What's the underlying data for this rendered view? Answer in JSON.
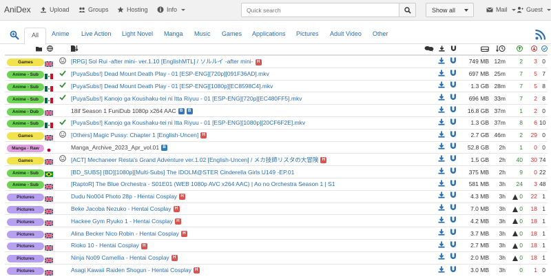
{
  "nav": {
    "brand": "AniDex",
    "upload": "Upload",
    "groups": "Groups",
    "hosting": "Hosting",
    "info": "Info",
    "search_placeholder": "Quick search",
    "show_all": "Show all",
    "mail": "Mail",
    "guest": "Guest"
  },
  "tabs": [
    "All",
    "Anime",
    "Live Action",
    "Light Novel",
    "Manga",
    "Music",
    "Games",
    "Applications",
    "Pictures",
    "Adult Video",
    "Other"
  ],
  "colors": {
    "Games": "#f2e24d",
    "Anime - Sub": "#6fd455",
    "Anime - Dub": "#6fd455",
    "Manga - Raw": "#e0a0e0",
    "Pictures": "#b8a0f0",
    "badge_h": "#d9534f",
    "badge_b": "#337ab7",
    "link": "#2a6fb0"
  },
  "rows": [
    {
      "cat": "Games",
      "flag": "uk",
      "status": "smile",
      "name": "[RPG] Sol Rui -after mini- ver.1.10 [EnglishMTL] / ソルルイ -after mini-",
      "badges": [
        "H"
      ],
      "size": "749 MB",
      "age": "12m",
      "seed": "2",
      "leech": "3",
      "comp": "0",
      "mono": false,
      "warn": false
    },
    {
      "cat": "Anime - Sub",
      "flag": "mx",
      "status": "check",
      "name": "[PuyaSubs!] Dead Mount Death Play - 01 [ESP-ENG][720p][091F36AD].mkv",
      "badges": [],
      "size": "697 MB",
      "age": "25m",
      "seed": "7",
      "leech": "5",
      "comp": "7",
      "mono": false,
      "warn": false
    },
    {
      "cat": "Anime - Sub",
      "flag": "mx",
      "status": "check",
      "name": "[PuyaSubs!] Dead Mount Death Play - 01 [ESP-ENG][1080p][EC8598C4].mkv",
      "badges": [],
      "size": "1.3 GB",
      "age": "28m",
      "seed": "7",
      "leech": "5",
      "comp": "8",
      "mono": false,
      "warn": false
    },
    {
      "cat": "Anime - Sub",
      "flag": "mx",
      "status": "check",
      "name": "[PuyaSubs!] Kanojo ga Koushaku-tei ni Itta Riyuu - 01 [ESP-ENG][720p][EC480FF5].mkv",
      "badges": [],
      "size": "696 MB",
      "age": "33m",
      "seed": "7",
      "leech": "2",
      "comp": "8",
      "mono": false,
      "warn": false
    },
    {
      "cat": "Anime - Dub",
      "flag": "uk",
      "status": "",
      "name": "18if Season 1 FuniDub 1080p x264 AAC",
      "badges": [
        "B",
        "B"
      ],
      "size": "16.8 GB",
      "age": "37m",
      "seed": "1",
      "leech": "2",
      "comp": "0",
      "mono": true,
      "warn": false
    },
    {
      "cat": "Anime - Sub",
      "flag": "mx",
      "status": "check",
      "name": "[PuyaSubs!] Kanojo ga Koushaku-tei ni Itta Riyuu - 01 [ESP-ENG][1080p][20CF6F2E].mkv",
      "badges": [],
      "size": "1.3 GB",
      "age": "37m",
      "seed": "8",
      "leech": "6",
      "comp": "10",
      "mono": false,
      "warn": false
    },
    {
      "cat": "Games",
      "flag": "uk",
      "status": "smile",
      "name": "[Others] Magic Pussy: Chapter 1 [English-Uncen]",
      "badges": [
        "H"
      ],
      "size": "2.7 GB",
      "age": "46m",
      "seed": "2",
      "leech": "29",
      "comp": "0",
      "mono": false,
      "warn": false
    },
    {
      "cat": "Manga - Raw",
      "flag": "jp",
      "status": "",
      "name": "Manga_Archive_2023_Apr_vol.01",
      "badges": [
        "B"
      ],
      "size": "52.8 GB",
      "age": "2h",
      "seed": "1",
      "leech": "0",
      "comp": "0",
      "mono": true,
      "warn": false
    },
    {
      "cat": "Games",
      "flag": "uk",
      "status": "smile",
      "name": "[ACT] Mechaneer Resta's Grand Adventure ver.1.02 [English-Uncen] / メカ技師リスタの大冒険",
      "badges": [
        "H"
      ],
      "size": "1.5 GB",
      "age": "2h",
      "seed": "40",
      "leech": "30",
      "comp": "74",
      "mono": false,
      "warn": false
    },
    {
      "cat": "Anime - Sub",
      "flag": "br",
      "status": "",
      "name": "[BD_SUBS] [BD][1080p][Multi-Subs] The IDOLM@STER Cinderella Girls U149 -EP.01",
      "badges": [],
      "size": "375 MB",
      "age": "2h",
      "seed": "9",
      "leech": "0",
      "comp": "22",
      "mono": false,
      "warn": false
    },
    {
      "cat": "Anime - Sub",
      "flag": "uk",
      "status": "",
      "name": "[RaptoR] The Blue Orchestra - S01E01 (WEB 1080p AVC x264 AAC) | Ao no Orchestra Season 1 | S1",
      "badges": [],
      "size": "581 MB",
      "age": "3h",
      "seed": "24",
      "leech": "3",
      "comp": "48",
      "mono": false,
      "warn": false
    },
    {
      "cat": "Pictures",
      "flag": "uk",
      "status": "",
      "name": "Dudu No004 Photo 28p - Hentai Cosplay",
      "badges": [
        "H"
      ],
      "size": "4.3 MB",
      "age": "3h",
      "seed": "0",
      "leech": "22",
      "comp": "1",
      "mono": false,
      "warn": true
    },
    {
      "cat": "Pictures",
      "flag": "uk",
      "status": "",
      "name": "Beke Jacoba Nezuko - Hentai Cosplay",
      "badges": [
        "H"
      ],
      "size": "7.0 MB",
      "age": "3h",
      "seed": "0",
      "leech": "18",
      "comp": "1",
      "mono": false,
      "warn": true
    },
    {
      "cat": "Pictures",
      "flag": "uk",
      "status": "",
      "name": "Hackee Gym Ryuko 1 - Hentai Cosplay",
      "badges": [
        "H"
      ],
      "size": "4.2 MB",
      "age": "3h",
      "seed": "0",
      "leech": "18",
      "comp": "1",
      "mono": false,
      "warn": true
    },
    {
      "cat": "Pictures",
      "flag": "uk",
      "status": "",
      "name": "Alina Becker Nico Robin - Hentai Cosplay",
      "badges": [
        "H"
      ],
      "size": "3.7 MB",
      "age": "3h",
      "seed": "0",
      "leech": "18",
      "comp": "1",
      "mono": false,
      "warn": true
    },
    {
      "cat": "Pictures",
      "flag": "uk",
      "status": "",
      "name": "Rioko 10 - Hentai Cosplay",
      "badges": [
        "H"
      ],
      "size": "2.7 MB",
      "age": "3h",
      "seed": "0",
      "leech": "18",
      "comp": "1",
      "mono": false,
      "warn": true
    },
    {
      "cat": "Pictures",
      "flag": "uk",
      "status": "",
      "name": "Ninja No09 Camellia - Hentai Cosplay",
      "badges": [
        "H"
      ],
      "size": "2.0 MB",
      "age": "3h",
      "seed": "0",
      "leech": "18",
      "comp": "1",
      "mono": false,
      "warn": true
    },
    {
      "cat": "Pictures",
      "flag": "uk",
      "status": "",
      "name": "Asagi Kawaii Raiden Shogun - Hentai Cosplay",
      "badges": [
        "H"
      ],
      "size": "3.0 MB",
      "age": "3h",
      "seed": "0",
      "leech": "1",
      "comp": "0",
      "mono": false,
      "warn": false
    }
  ]
}
